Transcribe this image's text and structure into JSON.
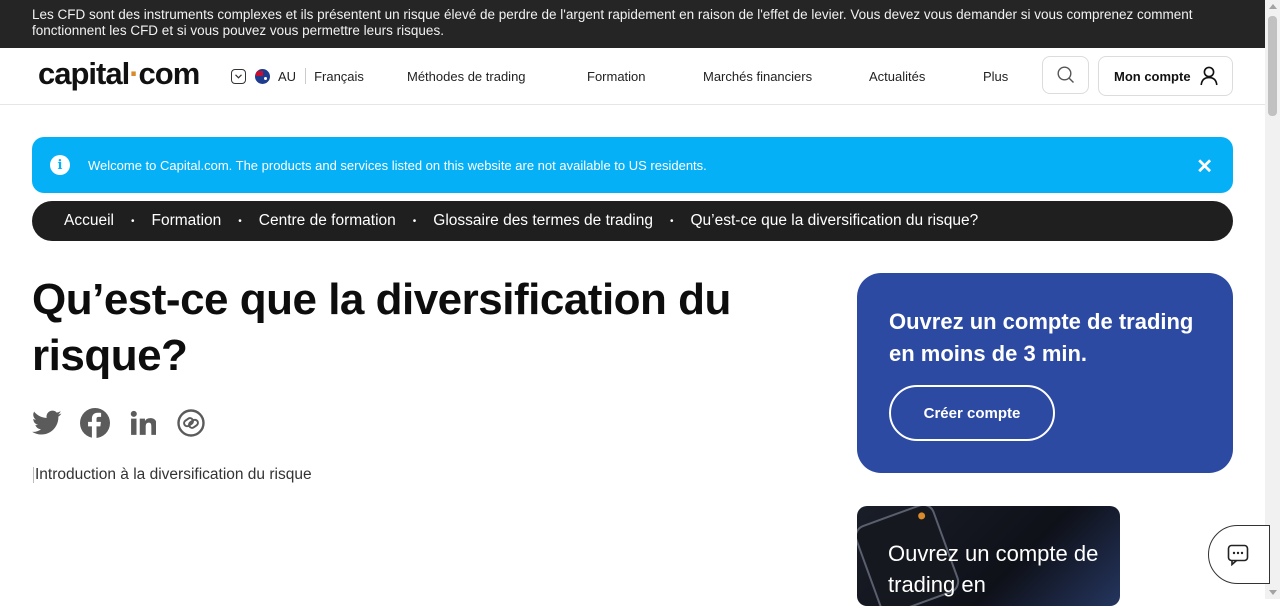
{
  "risk_warning": "Les CFD sont des instruments complexes et ils présentent un risque élevé de perdre de l'argent rapidement en raison de l'effet de levier. Vous devez vous demander si vous comprenez comment fonctionnent les CFD et si vous pouvez vous permettre leurs risques.",
  "header": {
    "logo_part1": "capital",
    "logo_dot": "·",
    "logo_part2": "com",
    "region_code": "AU",
    "language": "Français",
    "nav": [
      "Méthodes de trading",
      "Formation",
      "Marchés financiers",
      "Actualités",
      "Plus"
    ],
    "account_label": "Mon compte"
  },
  "notice": {
    "text": "Welcome to Capital.com. The products and services listed on this website are not available to US residents.",
    "close_symbol": "✕"
  },
  "breadcrumb": [
    "Accueil",
    "Formation",
    "Centre de formation",
    "Glossaire des termes de trading",
    "Qu’est-ce que la diversification du risque?"
  ],
  "breadcrumb_sep": "•",
  "article": {
    "title": "Qu’est-ce que la diversification du risque?",
    "image_alt": "Introduction à la diversification du risque",
    "share_icons": [
      "twitter-icon",
      "facebook-icon",
      "linkedin-icon",
      "copy-link-icon"
    ]
  },
  "cta": {
    "heading": "Ouvrez un compte de trading en moins de 3 min.",
    "button": "Créer compte"
  },
  "promo": {
    "text": "Ouvrez un compte de trading en"
  },
  "colors": {
    "risk_bar": "#252525",
    "notice": "#06b0f7",
    "breadcrumb": "#1f1f1f",
    "cta": "#2d4aa3",
    "brand_dot": "#d98b2b"
  }
}
